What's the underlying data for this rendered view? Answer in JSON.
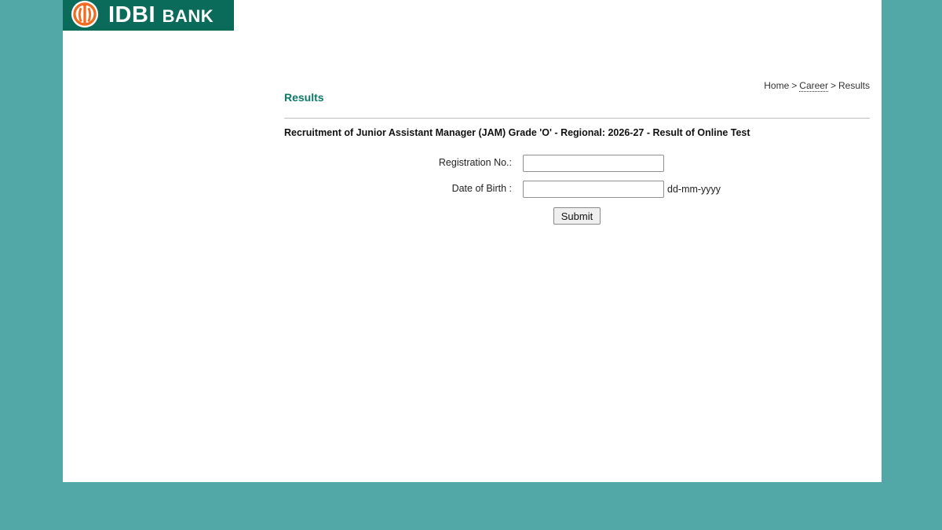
{
  "brand": {
    "logo_text_main": "IDBI",
    "logo_text_sub": "BANK",
    "logo_bg": "#0a6b5b",
    "emblem_color": "#f26b21"
  },
  "breadcrumb": {
    "home": "Home",
    "separator": ">",
    "career": "Career",
    "current": "Results"
  },
  "page": {
    "title": "Results",
    "subtitle": "Recruitment of Junior Assistant Manager (JAM) Grade 'O' - Regional: 2026-27 - Result of Online Test"
  },
  "form": {
    "registration_label": "Registration No.:",
    "registration_value": "",
    "dob_label": "Date of Birth :",
    "dob_value": "",
    "dob_hint": "dd-mm-yyyy",
    "submit_label": "Submit"
  },
  "colors": {
    "background": "#52a8a6",
    "title": "#0c7a68"
  }
}
